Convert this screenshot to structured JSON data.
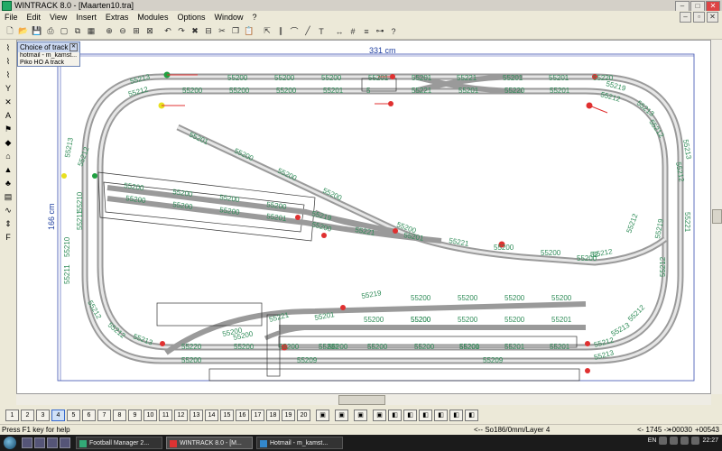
{
  "window": {
    "title": "WINTRACK 8.0 - [Maarten10.tra]"
  },
  "menu": [
    "File",
    "Edit",
    "View",
    "Insert",
    "Extras",
    "Modules",
    "Options",
    "Window",
    "?"
  ],
  "toolbar_icons": [
    "new-icon",
    "open-icon",
    "save-icon",
    "print-icon",
    "preview-icon",
    "copy-layout-icon",
    "palette-icon",
    "zoom-in-icon",
    "zoom-out-icon",
    "zoom-fit-icon",
    "zoom-area-icon",
    "undo-icon",
    "redo-icon",
    "delete-icon",
    "insert-icon",
    "cut-icon",
    "copy-icon",
    "paste-icon",
    "select-icon",
    "track-icon",
    "curve-icon",
    "edit-track-icon",
    "text-icon",
    "measure-icon",
    "grid-icon",
    "align-icon",
    "connect-icon",
    "help-icon"
  ],
  "left_tools": [
    "track-tool-1",
    "track-tool-2",
    "track-tool-3",
    "switch-tool",
    "crossing-tool",
    "text-tool",
    "signal-tool",
    "object-tool",
    "building-tool",
    "terrain-tool",
    "scenery-tool",
    "layer-tool",
    "flex-tool",
    "height-tool",
    "function-tool"
  ],
  "choice_panel": {
    "title": "Choice of track",
    "row1": "hotmail - m_kamst...",
    "row2": "Piko HO A track"
  },
  "layout": {
    "width_label": "331 cm",
    "height_label": "166 cm",
    "top_outer_labels": [
      "55213",
      "55200",
      "55200",
      "55200",
      "55201",
      "55201",
      "55221",
      "55201",
      "55201",
      "55220",
      "55219"
    ],
    "top_inner_labels": [
      "55212",
      "55200",
      "55200",
      "55200",
      "55201",
      "5",
      "55221",
      "55201",
      "55220",
      "55201",
      "55212"
    ],
    "diag_labels": [
      "55201",
      "55200",
      "55200",
      "55200",
      "55200",
      "55221",
      "55200",
      "55200",
      "55200",
      "52",
      "55212"
    ],
    "siding_labels": [
      "55200",
      "55200",
      "55200",
      "55200",
      "55219",
      "55200",
      "55200",
      "55200",
      "55201",
      "55200",
      "55221",
      "55201"
    ],
    "left_labels": [
      "55213",
      "55212",
      "55210",
      "55211",
      "55210",
      "55211",
      "55212",
      "55212",
      "55213"
    ],
    "right_labels": [
      "55213",
      "55212",
      "55213",
      "55212",
      "55221",
      "55212",
      "55219",
      "55212",
      "55212",
      "55213"
    ],
    "bottom_siding_labels": [
      "55219",
      "55200",
      "55200",
      "55200",
      "55200",
      "55200",
      "55201",
      "55200",
      "55200",
      "55200",
      "55200",
      "55201",
      "55201",
      "55200",
      "55200",
      "55200",
      "55200",
      "55221",
      "55200"
    ],
    "bottom_outer_labels": [
      "55220",
      "55200",
      "55200",
      "55200",
      "55201",
      "55201",
      "55201",
      "55212"
    ],
    "bottom_inner_labels": [
      "55200",
      "55209",
      "55209",
      "55213"
    ]
  },
  "layers": [
    "1",
    "2",
    "3",
    "4",
    "5",
    "6",
    "7",
    "8",
    "9",
    "10",
    "11",
    "12",
    "13",
    "14",
    "15",
    "16",
    "17",
    "18",
    "19",
    "20"
  ],
  "status": {
    "help": "Press F1 key for help",
    "track": "<-- So186/0mm/Layer 4",
    "angle": "<- 1745 ->",
    "coords": "+00030",
    "coords2": "+00543"
  },
  "taskbar": {
    "tasks": [
      "Football Manager 2...",
      "WINTRACK 8.0 - [M...",
      "Hotmail - m_kamst..."
    ],
    "lang": "EN",
    "clock": "22:27"
  },
  "colors": {
    "label": "#2e8b57",
    "dimension": "#1f3fa0",
    "signal_red": "#e03030",
    "signal_green": "#20a040",
    "signal_yellow": "#e8e020",
    "track": "#b0b0b0"
  }
}
